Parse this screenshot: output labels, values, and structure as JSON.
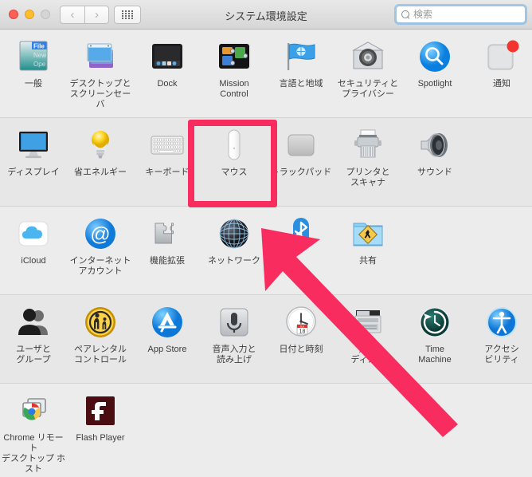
{
  "window": {
    "title": "システム環境設定",
    "traffic_lights": [
      "close",
      "minimize",
      "zoom"
    ],
    "nav": {
      "back_label": "‹",
      "forward_label": "›",
      "grid_label": "grid-view"
    },
    "search": {
      "placeholder": "検索",
      "value": ""
    }
  },
  "annotation": {
    "highlight_target": "マウス",
    "highlight_color": "#f92c60",
    "arrow_color": "#f92c60",
    "arrow_tip": "328,286",
    "arrow_tail": "570,525"
  },
  "rows": [
    {
      "panes": [
        {
          "label": "一般",
          "icon": "general-icon"
        },
        {
          "label": "デスクトップと\nスクリーンセーバ",
          "icon": "desktop-screensaver-icon"
        },
        {
          "label": "Dock",
          "icon": "dock-icon"
        },
        {
          "label": "Mission\nControl",
          "icon": "mission-control-icon"
        },
        {
          "label": "言語と地域",
          "icon": "language-region-icon"
        },
        {
          "label": "セキュリティと\nプライバシー",
          "icon": "security-privacy-icon"
        },
        {
          "label": "Spotlight",
          "icon": "spotlight-icon"
        },
        {
          "label": "通知",
          "icon": "notifications-icon"
        }
      ]
    },
    {
      "panes": [
        {
          "label": "ディスプレイ",
          "icon": "displays-icon"
        },
        {
          "label": "省エネルギー",
          "icon": "energy-saver-icon"
        },
        {
          "label": "キーボード",
          "icon": "keyboard-icon"
        },
        {
          "label": "マウス",
          "icon": "mouse-icon"
        },
        {
          "label": "トラックパッド",
          "icon": "trackpad-icon"
        },
        {
          "label": "プリンタと\nスキャナ",
          "icon": "printers-scanners-icon"
        },
        {
          "label": "サウンド",
          "icon": "sound-icon"
        },
        {
          "label": "",
          "icon": ""
        }
      ]
    },
    {
      "panes": [
        {
          "label": "iCloud",
          "icon": "icloud-icon"
        },
        {
          "label": "インターネット\nアカウント",
          "icon": "internet-accounts-icon"
        },
        {
          "label": "機能拡張",
          "icon": "extensions-icon"
        },
        {
          "label": "ネットワーク",
          "icon": "network-icon"
        },
        {
          "label": "",
          "icon": "bluetooth-icon"
        },
        {
          "label": "共有",
          "icon": "sharing-icon"
        },
        {
          "label": "",
          "icon": ""
        },
        {
          "label": "",
          "icon": ""
        }
      ]
    },
    {
      "panes": [
        {
          "label": "ユーザと\nグループ",
          "icon": "users-groups-icon"
        },
        {
          "label": "ペアレンタル\nコントロール",
          "icon": "parental-controls-icon"
        },
        {
          "label": "App Store",
          "icon": "app-store-icon"
        },
        {
          "label": "音声入力と\n読み上げ",
          "icon": "dictation-speech-icon"
        },
        {
          "label": "日付と時刻",
          "icon": "date-time-icon"
        },
        {
          "label": "起動\nディスク",
          "icon": "startup-disk-icon"
        },
        {
          "label": "Time\nMachine",
          "icon": "time-machine-icon"
        },
        {
          "label": "アクセシ\nビリティ",
          "icon": "accessibility-icon"
        }
      ]
    },
    {
      "panes": [
        {
          "label": "Chrome リモート\nデスクトップ ホスト",
          "icon": "chrome-remote-desktop-icon"
        },
        {
          "label": "Flash Player",
          "icon": "flash-player-icon"
        },
        {
          "label": "",
          "icon": ""
        },
        {
          "label": "",
          "icon": ""
        },
        {
          "label": "",
          "icon": ""
        },
        {
          "label": "",
          "icon": ""
        },
        {
          "label": "",
          "icon": ""
        },
        {
          "label": "",
          "icon": ""
        }
      ]
    }
  ]
}
